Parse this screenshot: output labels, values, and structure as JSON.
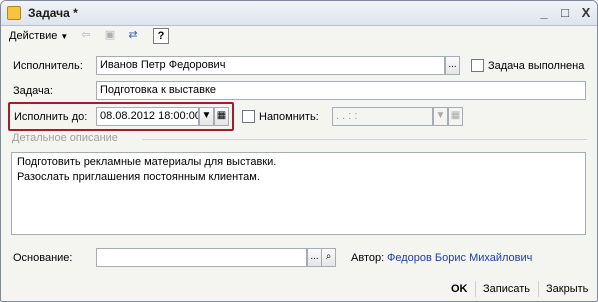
{
  "window": {
    "title": "Задача *"
  },
  "titlebar": {
    "minimize": "_",
    "maximize": "□",
    "close": "X"
  },
  "toolbar": {
    "actions_label": "Действие",
    "help_label": "?"
  },
  "form": {
    "executor_label": "Исполнитель:",
    "executor_value": "Иванов Петр Федорович",
    "select_btn": "...",
    "done_label": "Задача выполнена",
    "task_label": "Задача:",
    "task_value": "Подготовка к выставке",
    "due_label": "Исполнить до:",
    "due_value": "08.08.2012 18:00:00",
    "remind_label": "Напомнить:",
    "remind_value": ". .   : :",
    "section_title": "Детальное описание",
    "description": "Подготовить рекламные материалы для выставки.\nРазослать приглашения постоянным клиентам.",
    "basis_label": "Основание:",
    "basis_value": "",
    "author_label": "Автор:",
    "author_value": "Федоров Борис Михайлович"
  },
  "buttons": {
    "ok": "OK",
    "save": "Записать",
    "close": "Закрыть"
  },
  "colors": {
    "highlight_frame": "#a51d2d",
    "link": "#1e3f9e"
  }
}
